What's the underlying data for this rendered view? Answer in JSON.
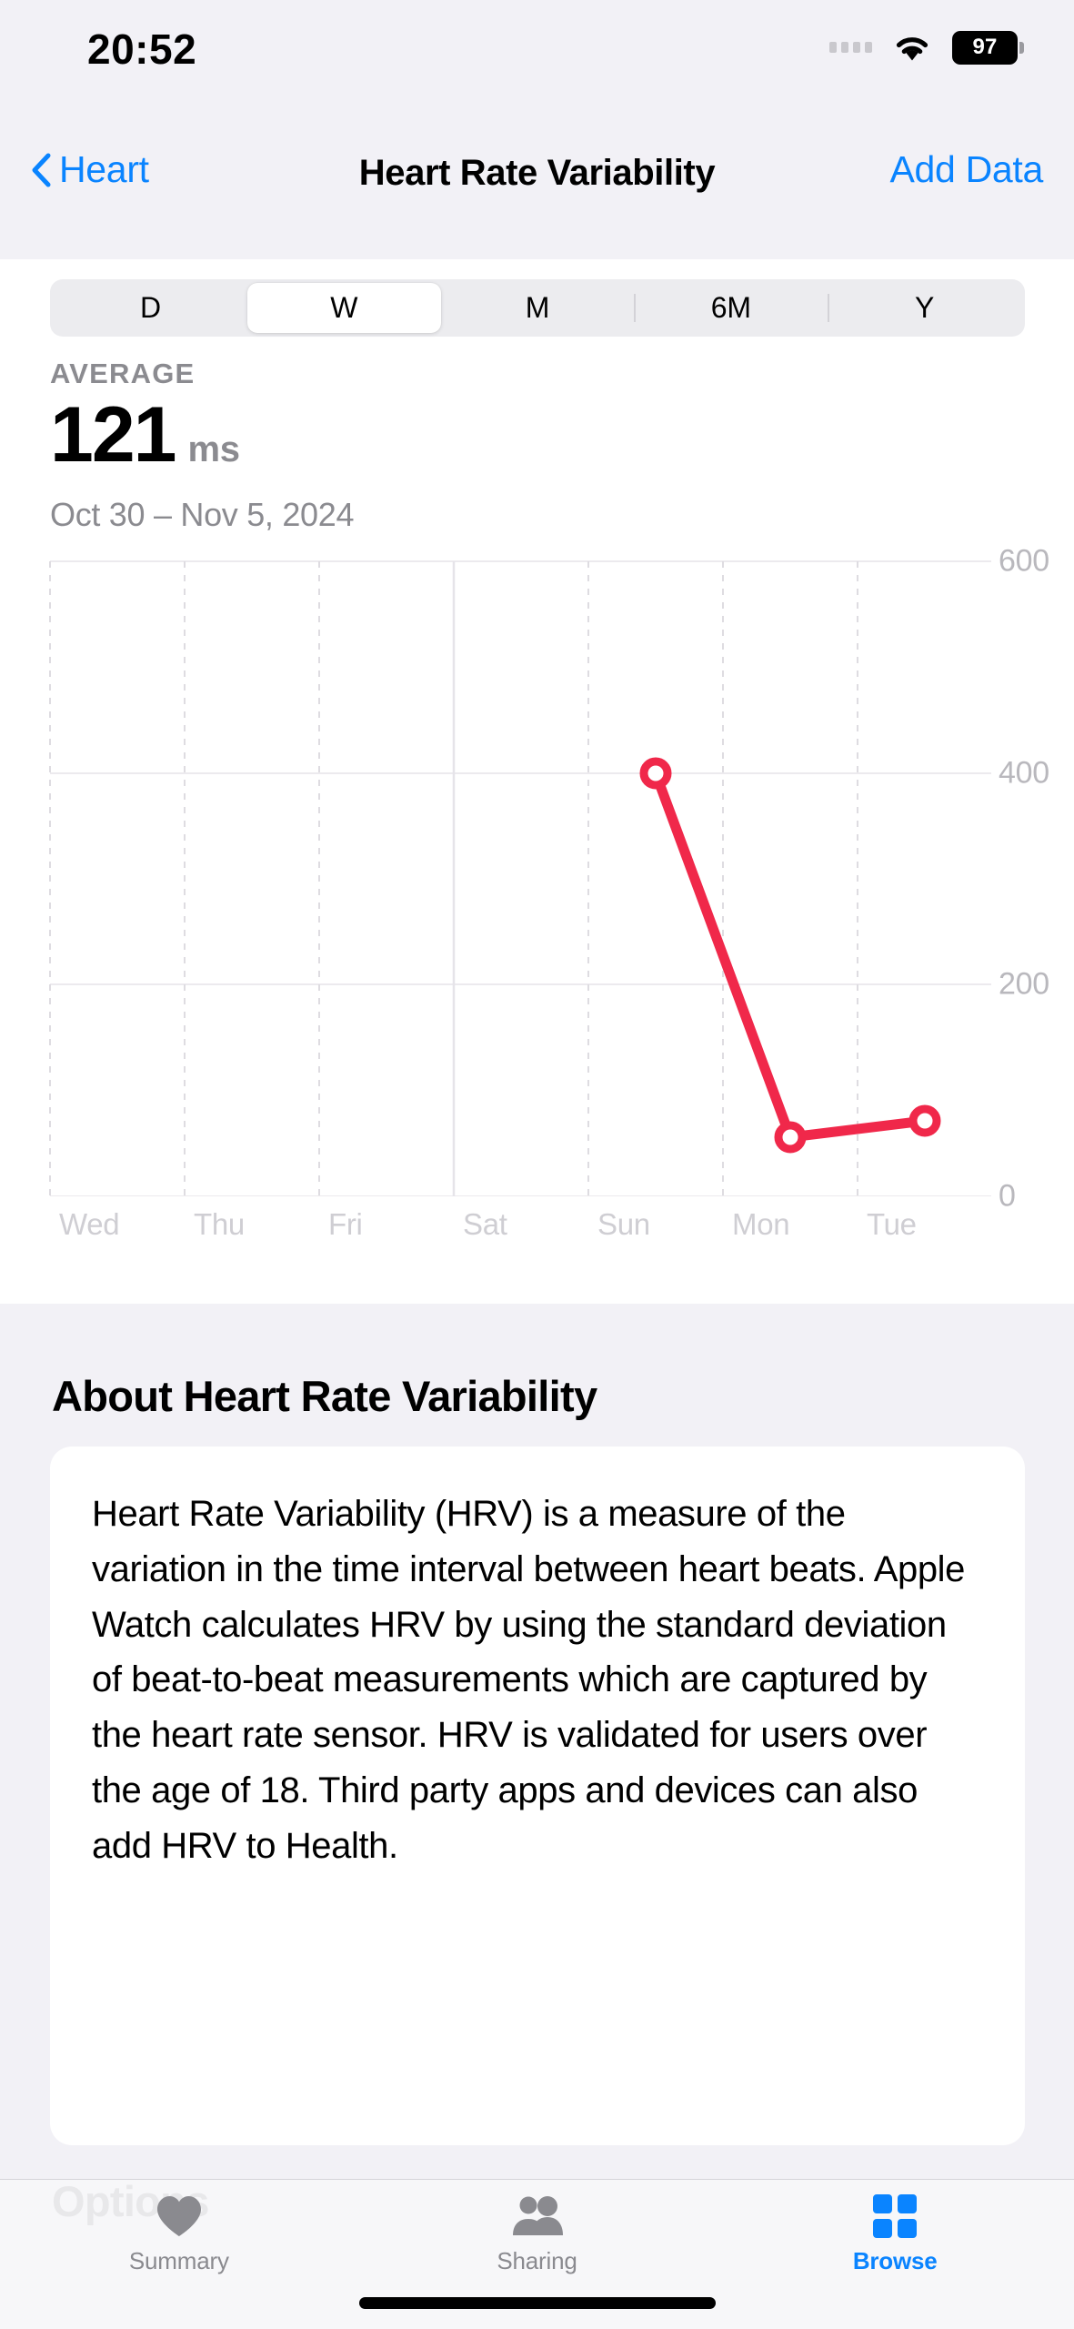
{
  "status_bar": {
    "time": "20:52",
    "battery_percent": "97",
    "icons": [
      "signal-dots-icon",
      "wifi-icon",
      "battery-icon"
    ]
  },
  "nav": {
    "back_label": "Heart",
    "back_icon": "chevron-left-icon",
    "title": "Heart Rate Variability",
    "action_label": "Add Data"
  },
  "segmented_control": {
    "options": [
      "D",
      "W",
      "M",
      "6M",
      "Y"
    ],
    "selected": "W"
  },
  "summary": {
    "label": "AVERAGE",
    "value": "121",
    "unit": "ms",
    "date_range": "Oct 30 – Nov 5, 2024"
  },
  "about": {
    "heading": "About Heart Rate Variability",
    "body": "Heart Rate Variability (HRV) is a measure of the variation in the time interval between heart beats. Apple Watch calculates HRV by using the standard deviation of beat-to-beat measurements which are captured by the heart rate sensor. HRV is validated for users over the age of 18. Third party apps and devices can also add HRV to Health."
  },
  "options_section": {
    "heading": "Options"
  },
  "tab_bar": {
    "tabs": [
      {
        "label": "Summary",
        "icon": "heart-icon",
        "active": false
      },
      {
        "label": "Sharing",
        "icon": "people-icon",
        "active": false
      },
      {
        "label": "Browse",
        "icon": "grid-squares-icon",
        "active": true
      }
    ],
    "active_color": "#0a84ff",
    "inactive_color": "#8a8a8f"
  },
  "colors": {
    "accent": "#0a84ff",
    "chart_line": "#f0284a",
    "background": "#f2f1f6",
    "card": "#ffffff"
  },
  "chart_data": {
    "type": "line",
    "title": "Heart Rate Variability",
    "xlabel": "",
    "ylabel": "ms",
    "unit": "ms",
    "categories": [
      "Wed",
      "Thu",
      "Fri",
      "Sat",
      "Sun",
      "Mon",
      "Tue"
    ],
    "ytick_labels": [
      "600",
      "400",
      "200",
      "0"
    ],
    "yticks": [
      600,
      400,
      200,
      0
    ],
    "ylim": [
      0,
      600
    ],
    "grid": true,
    "legend": false,
    "series": [
      {
        "name": "Heart Rate Variability",
        "color": "#f0284a",
        "marker": "open-circle",
        "points": [
          {
            "x": "Sun",
            "value": 400
          },
          {
            "x": "Mon",
            "value": 60
          },
          {
            "x": "Tue",
            "value": 75
          }
        ]
      }
    ],
    "values": [
      null,
      null,
      null,
      null,
      400,
      60,
      75
    ]
  }
}
